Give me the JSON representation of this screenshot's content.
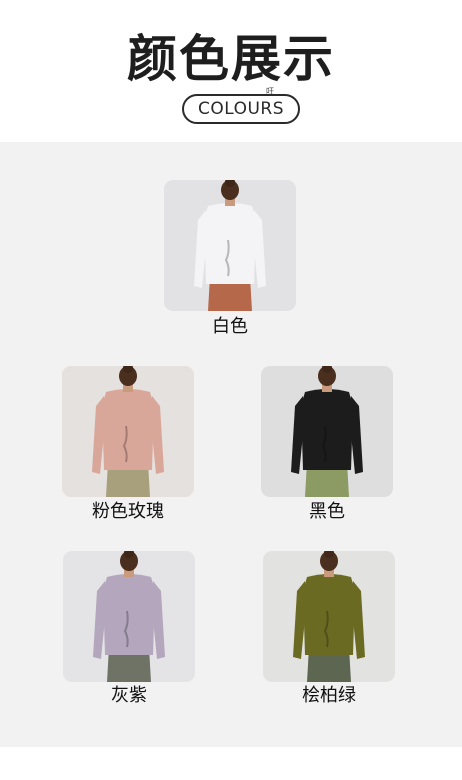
{
  "header": {
    "title": "颜色展示",
    "subtitle": "COLOURS",
    "mark": "㕵"
  },
  "products": [
    {
      "label": "白色",
      "shirt": "#f4f4f6",
      "pants": "#b5684a",
      "bg": "#e2e2e4"
    },
    {
      "label": "粉色玫瑰",
      "shirt": "#d9a69a",
      "pants": "#a8a07c",
      "bg": "#e4e1de"
    },
    {
      "label": "黑色",
      "shirt": "#1c1c1c",
      "pants": "#8c9a64",
      "bg": "#dedede"
    },
    {
      "label": "灰紫",
      "shirt": "#b3a6bd",
      "pants": "#6e7365",
      "bg": "#e4e4e6"
    },
    {
      "label": "桧柏绿",
      "shirt": "#6b6a22",
      "pants": "#5d6650",
      "bg": "#e2e2e0"
    }
  ]
}
